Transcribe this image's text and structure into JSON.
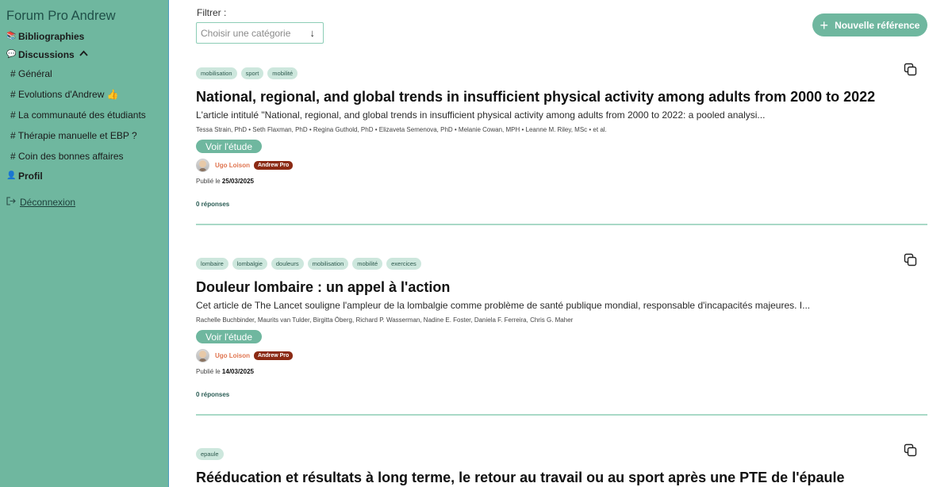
{
  "sidebar": {
    "brand": "Forum Pro Andrew",
    "items": [
      {
        "emoji": "📚",
        "label": "Bibliographies",
        "bold": true
      },
      {
        "emoji": "💬",
        "label": "Discussions",
        "bold": true,
        "chevron": "^"
      },
      {
        "label": "# Général"
      },
      {
        "label": "# Evolutions d'Andrew 👍"
      },
      {
        "label": "# La communauté des étudiants"
      },
      {
        "label": "# Thérapie manuelle et EBP ?"
      },
      {
        "label": "# Coin des bonnes affaires"
      },
      {
        "emoji": "👤",
        "label": "Profil",
        "bold": true
      }
    ],
    "logout": "Déconnexion"
  },
  "filter": {
    "label": "Filtrer :",
    "placeholder": "Choisir une catégorie",
    "arrow": "↓"
  },
  "new_reference_button": "Nouvelle référence",
  "posts": [
    {
      "tags": [
        "mobilisation",
        "sport",
        "mobilité"
      ],
      "title": "National, regional, and global trends in insufficient physical activity among adults from 2000 to 2022",
      "excerpt": "L'article intitulé \"National, regional, and global trends in insufficient physical activity among adults from 2000 to 2022: a pooled analysi...",
      "authors": "Tessa Strain, PhD • Seth Flaxman, PhD • Regina Guthold, PhD • Elizaveta Semenova, PhD • Melanie Cowan, MPH • Leanne M. Riley, MSc • et al.",
      "study_button": "Voir l'étude",
      "poster": "Ugo Loison",
      "badge": "Andrew Pro",
      "published_prefix": "Publié le",
      "published_date": "25/03/2025",
      "replies": "0 réponses"
    },
    {
      "tags": [
        "lombaire",
        "lombalgie",
        "douleurs",
        "mobilisation",
        "mobilité",
        "exercices"
      ],
      "title": "Douleur lombaire : un appel à l'action",
      "excerpt": "Cet article de The Lancet souligne l'ampleur de la lombalgie comme problème de santé publique mondial, responsable d'incapacités majeures. I...",
      "authors": "Rachelle Buchbinder, Maurits van Tulder, Birgitta Öberg, Richard P. Wasserman, Nadine E. Foster, Daniela F. Ferreira, Chris G. Maher",
      "study_button": "Voir l'étude",
      "poster": "Ugo Loison",
      "badge": "Andrew Pro",
      "published_prefix": "Publié le",
      "published_date": "14/03/2025",
      "replies": "0 réponses"
    },
    {
      "tags": [
        "epaule"
      ],
      "title": "Rééducation et résultats à long terme, le retour au travail ou au sport après une PTE de l'épaule"
    }
  ],
  "colors": {
    "sidebar_bg": "#6fb79f",
    "accent": "#6fb79f",
    "tag_bg": "#cde7dd",
    "poster_name": "#e0744f",
    "badge_bg": "#8b2a14"
  }
}
